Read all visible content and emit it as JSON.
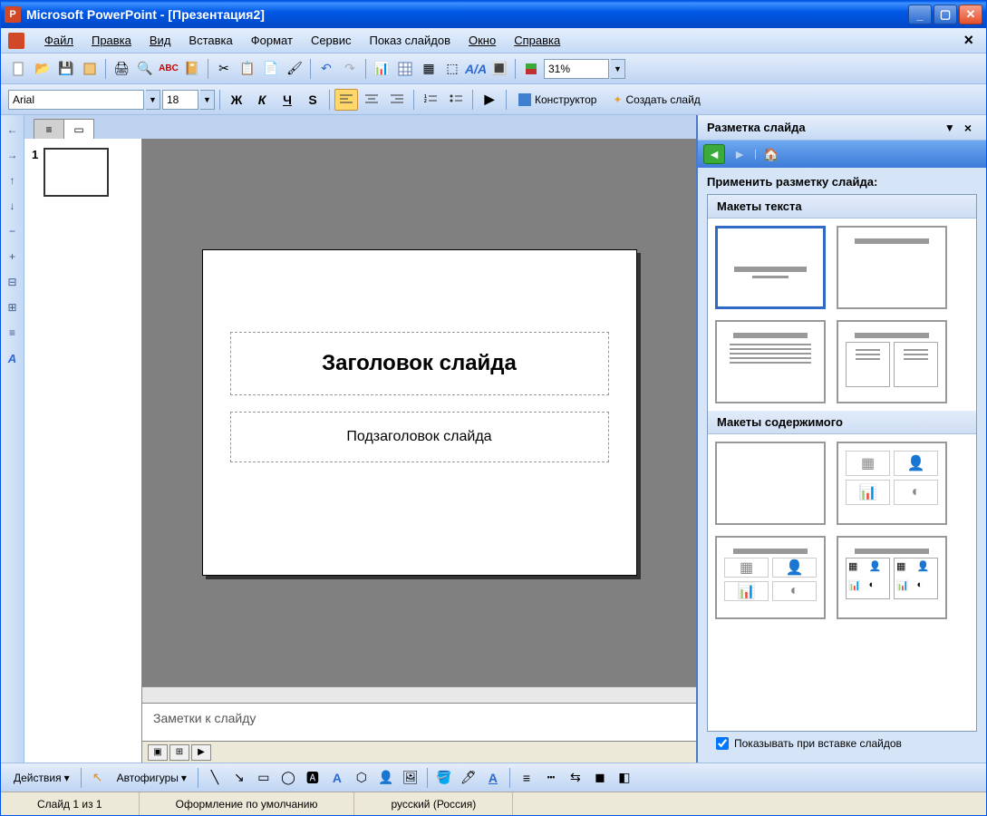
{
  "titlebar": {
    "app_title": "Microsoft PowerPoint - [Презентация2]"
  },
  "menu": {
    "file": "Файл",
    "edit": "Правка",
    "view": "Вид",
    "insert": "Вставка",
    "format": "Формат",
    "tools": "Сервис",
    "slideshow": "Показ слайдов",
    "window": "Окно",
    "help": "Справка"
  },
  "toolbar1": {
    "zoom": "31%"
  },
  "toolbar2": {
    "font": "Arial",
    "size": "18",
    "designer": "Конструктор",
    "new_slide": "Создать слайд"
  },
  "thumbs": {
    "slide1_num": "1"
  },
  "slide": {
    "title_placeholder": "Заголовок слайда",
    "subtitle_placeholder": "Подзаголовок слайда"
  },
  "notes": {
    "placeholder": "Заметки к слайду"
  },
  "taskpane": {
    "title": "Разметка слайда",
    "apply_label": "Применить разметку слайда:",
    "section_text": "Макеты текста",
    "section_content": "Макеты содержимого",
    "footer_checkbox": "Показывать при вставке слайдов"
  },
  "drawbar": {
    "actions": "Действия",
    "autoshapes": "Автофигуры"
  },
  "status": {
    "slide": "Слайд 1 из 1",
    "design": "Оформление по умолчанию",
    "lang": "русский (Россия)"
  }
}
